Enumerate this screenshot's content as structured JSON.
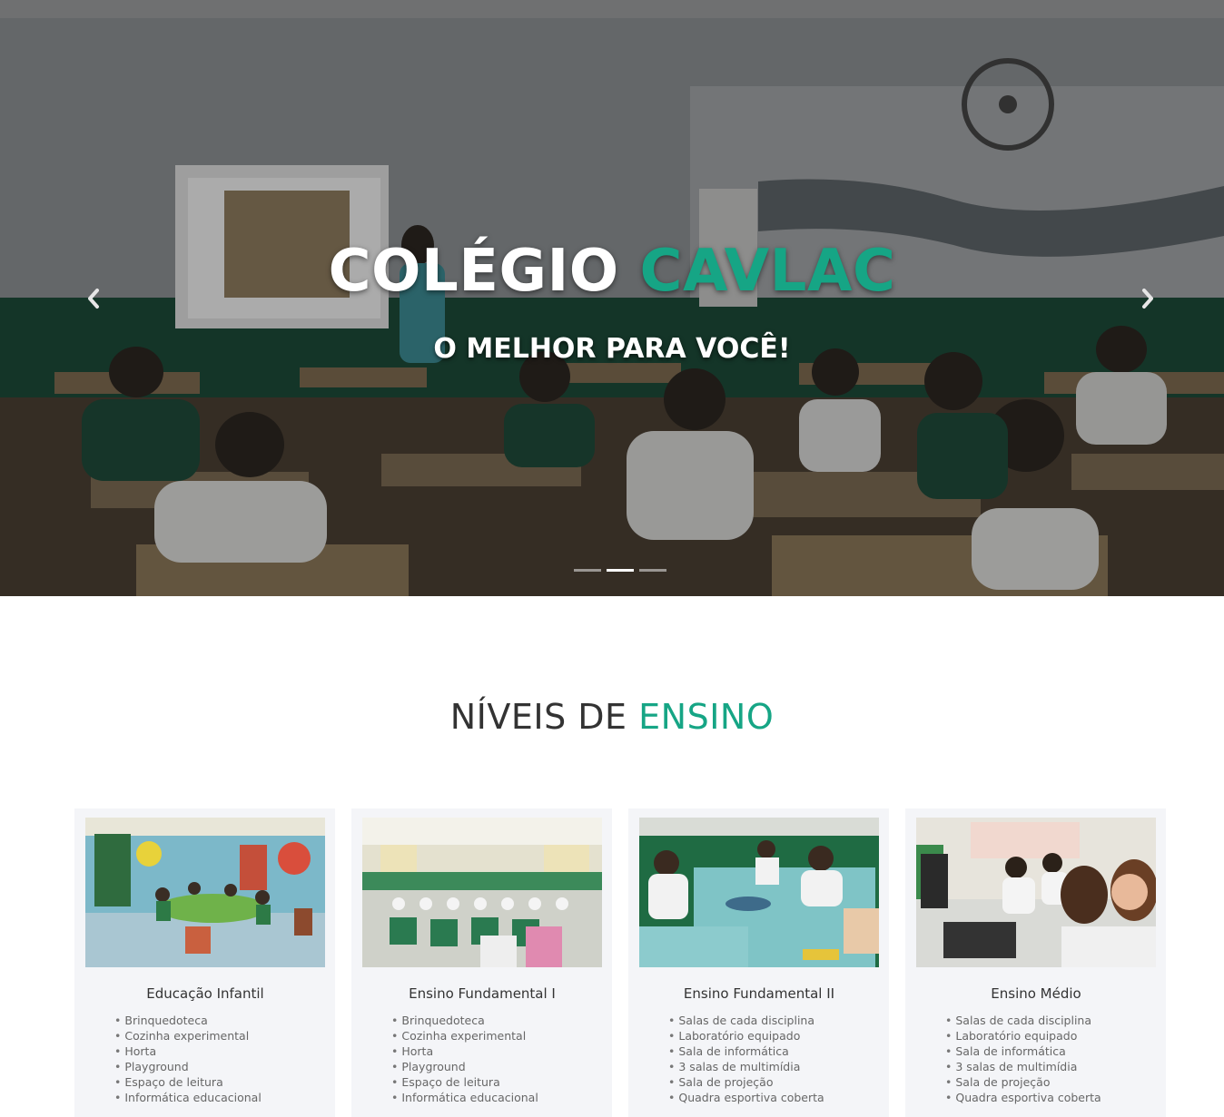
{
  "hero": {
    "title_main": "COLÉGIO",
    "title_accent": "CAVLAC",
    "subtitle": "O MELHOR PARA VOCÊ!",
    "prev_icon": "chevron-left-icon",
    "next_icon": "chevron-right-icon",
    "slides_count": 3,
    "active_slide": 2
  },
  "section": {
    "title_main": "NÍVEIS DE",
    "title_accent": "ENSINO"
  },
  "colors": {
    "accent": "#16a585",
    "card_bg": "#f4f5f8",
    "heading": "#333333"
  },
  "levels": [
    {
      "title": "Educação Infantil",
      "image": "classroom-colorful-photo",
      "items": [
        "Brinquedoteca",
        "Cozinha experimental",
        "Horta",
        "Playground",
        "Espaço de leitura",
        "Informática educacional"
      ]
    },
    {
      "title": "Ensino Fundamental I",
      "image": "auditorium-students-photo",
      "items": [
        "Brinquedoteca",
        "Cozinha experimental",
        "Horta",
        "Playground",
        "Espaço de leitura",
        "Informática educacional"
      ]
    },
    {
      "title": "Ensino Fundamental II",
      "image": "students-desks-photo",
      "items": [
        "Salas de cada disciplina",
        "Laboratório equipado",
        "Sala de informática",
        "3 salas de multimídia",
        "Sala de projeção",
        "Quadra esportiva coberta"
      ]
    },
    {
      "title": "Ensino Médio",
      "image": "computer-lab-photo",
      "items": [
        "Salas de cada disciplina",
        "Laboratório equipado",
        "Sala de informática",
        "3 salas de multimídia",
        "Sala de projeção",
        "Quadra esportiva coberta"
      ]
    }
  ]
}
